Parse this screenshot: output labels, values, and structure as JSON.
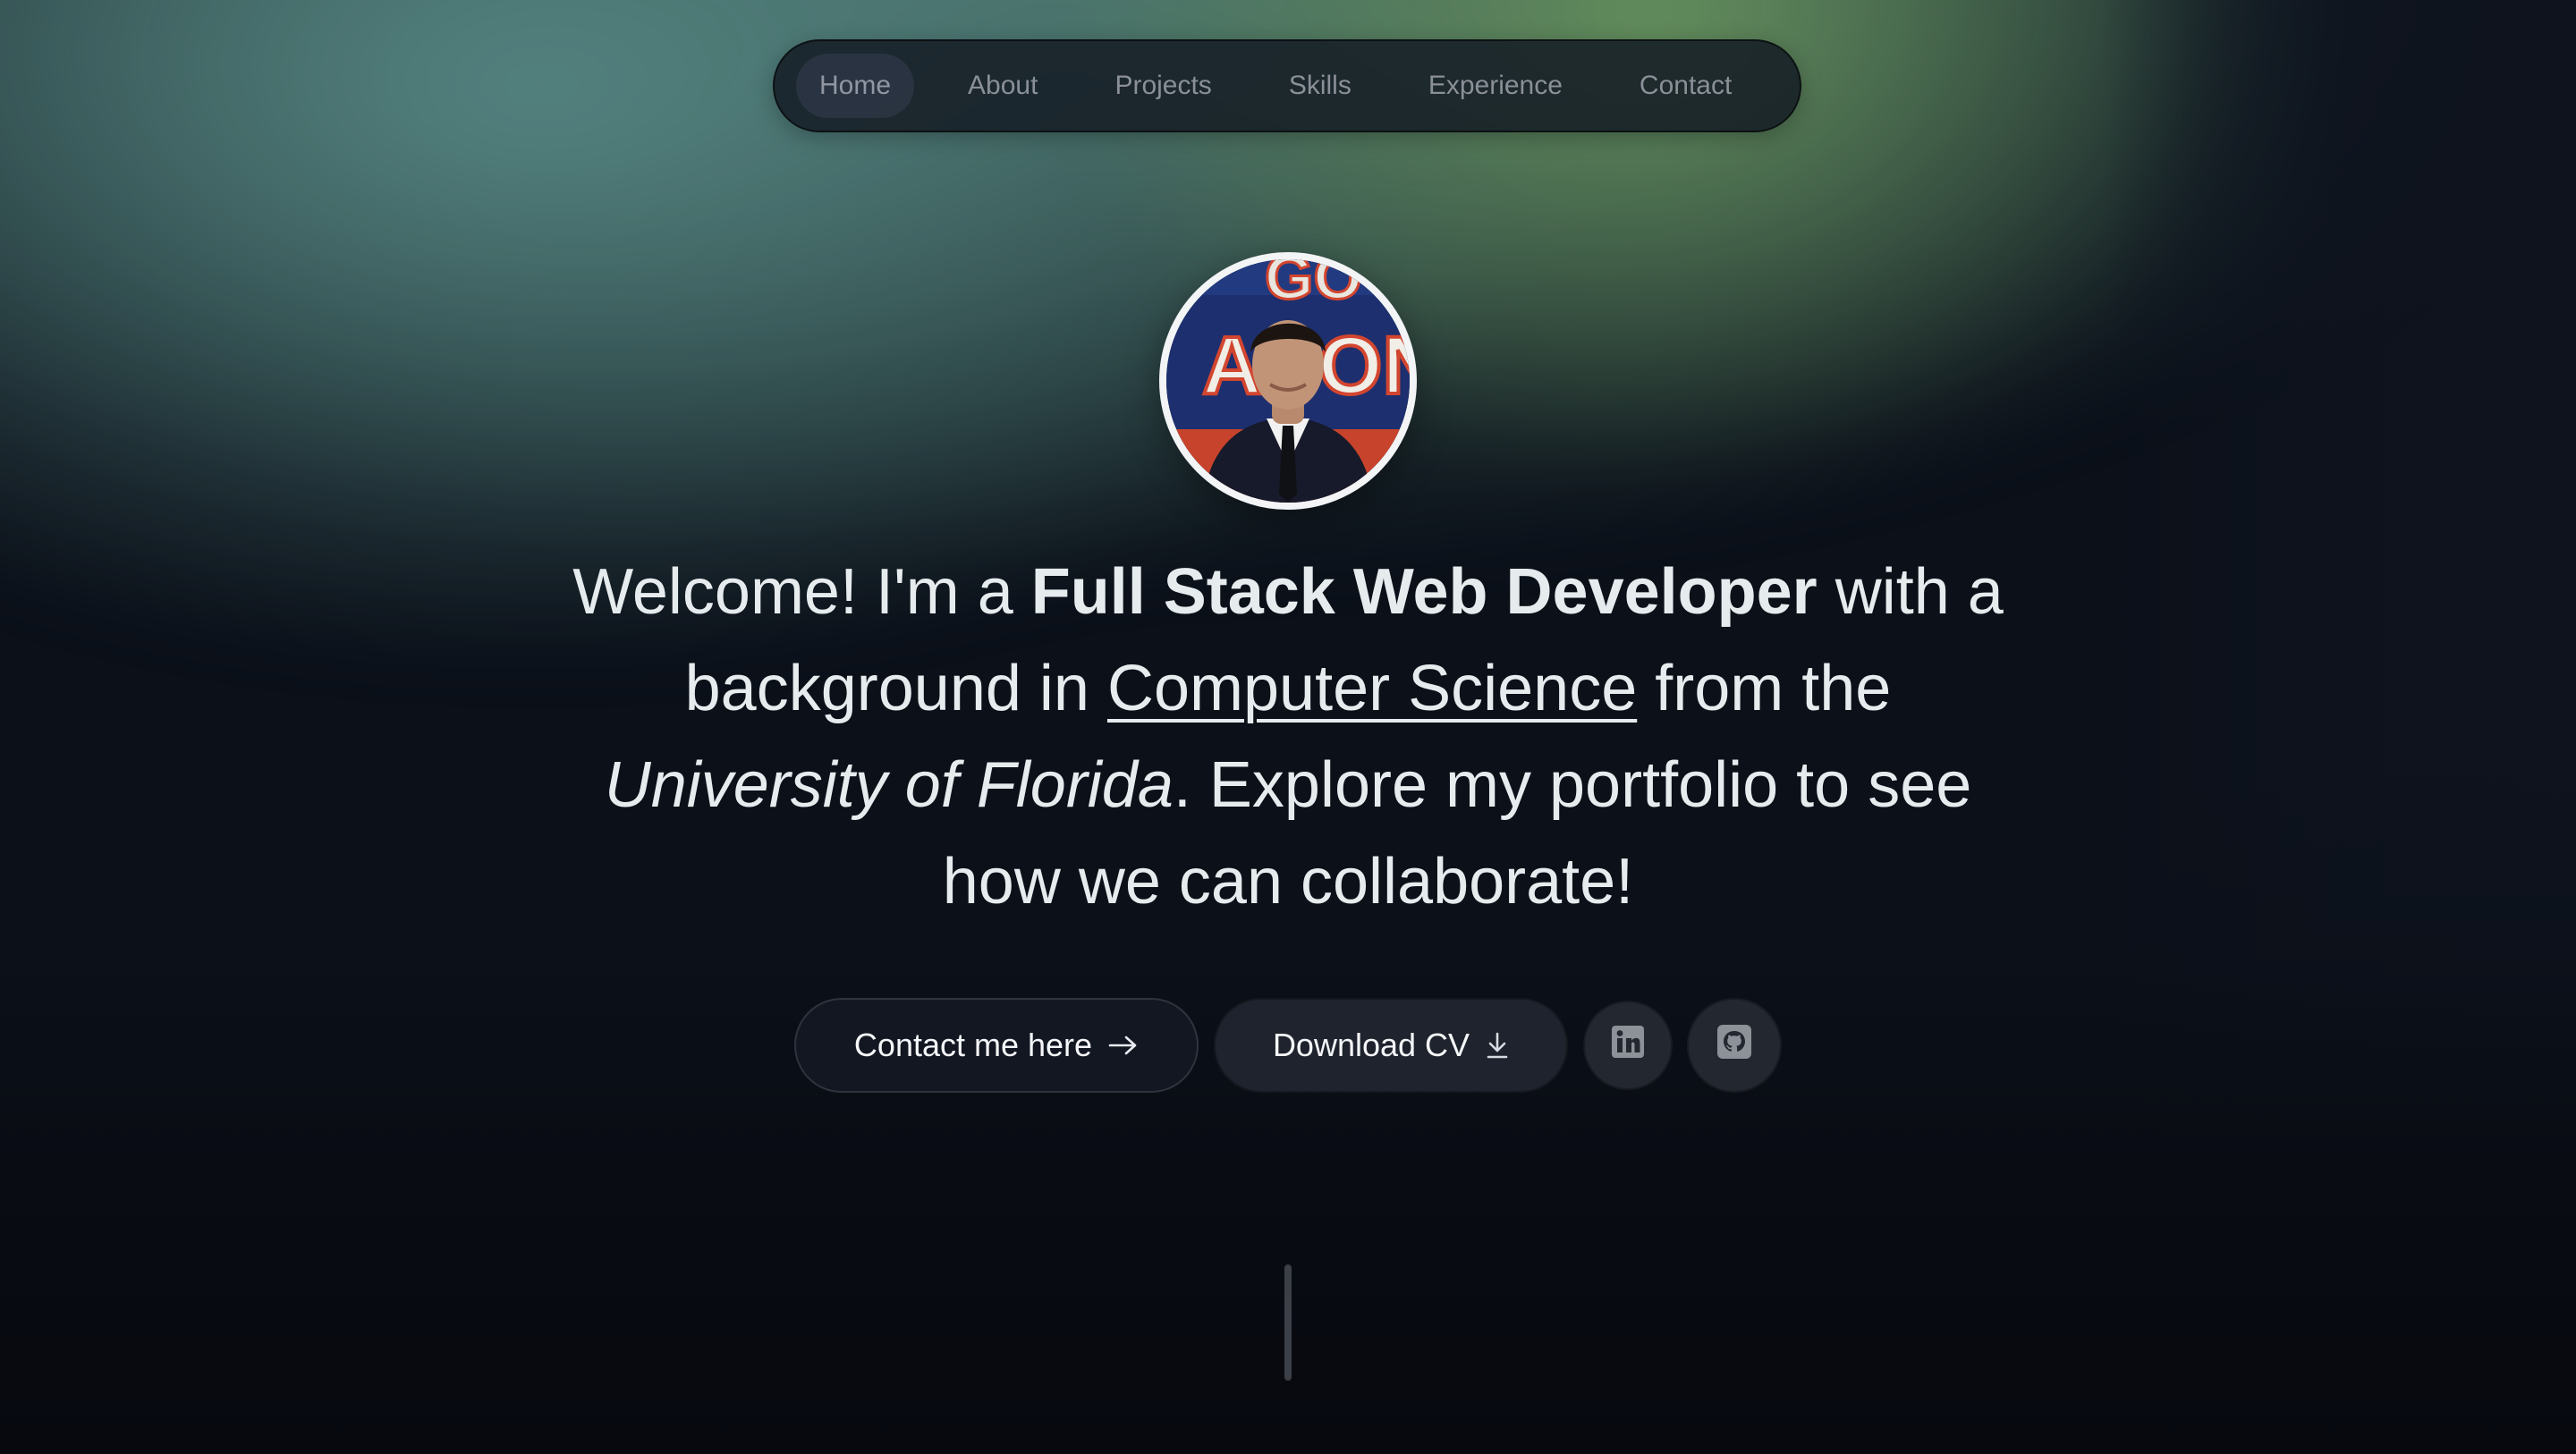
{
  "nav": {
    "items": [
      {
        "label": "Home",
        "active": true
      },
      {
        "label": "About"
      },
      {
        "label": "Projects"
      },
      {
        "label": "Skills"
      },
      {
        "label": "Experience"
      },
      {
        "label": "Contact"
      }
    ]
  },
  "hero": {
    "intro": "Welcome! I'm a ",
    "role": "Full Stack Web Developer",
    "mid": " with a background in ",
    "field": "Computer Science",
    "from": " from the ",
    "school": "University of Florida",
    "outro": ". Explore my portfolio to see how we can collaborate!"
  },
  "buttons": {
    "contact_label": "Contact me here",
    "cv_label": "Download CV",
    "linkedin_icon": "linkedin-icon",
    "github_icon": "github-icon",
    "contact_icon": "arrow-right-icon",
    "cv_icon": "download-icon"
  },
  "colors": {
    "background": "#0b1019",
    "accent_green": "#67925e",
    "accent_teal": "#548380",
    "text": "#e6ebee"
  }
}
